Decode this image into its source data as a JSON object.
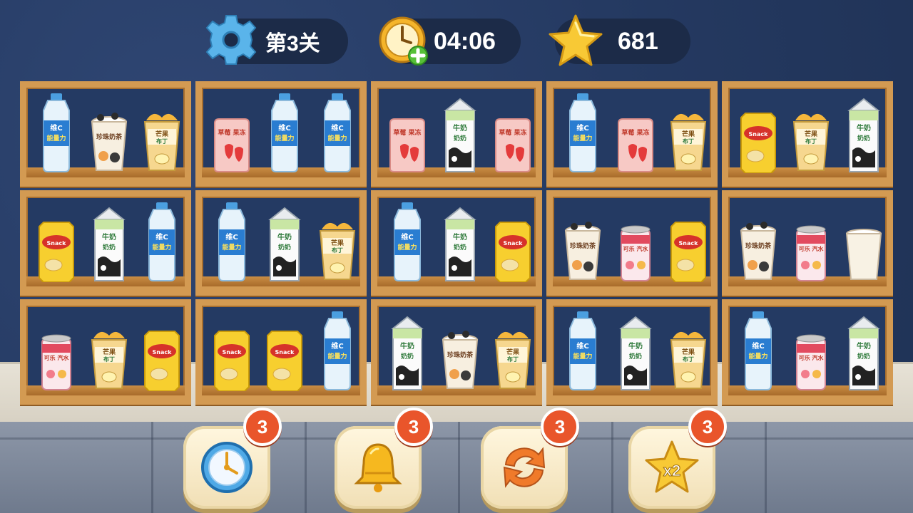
{
  "hud": {
    "level_label": "第3关",
    "timer": "04:06",
    "score": "681"
  },
  "item_labels": {
    "water": "维C 能量力",
    "milk": "牛奶 奶奶",
    "cup": "珍珠奶茶",
    "mango": "芒果 布丁",
    "strawberry": "草莓 果冻",
    "chips": "Snack",
    "can": "可乐 汽水"
  },
  "shelves": [
    [
      [
        "water",
        "cup",
        "mango"
      ],
      [
        "strawberry",
        "water",
        "water"
      ],
      [
        "strawberry",
        "milk",
        "strawberry"
      ],
      [
        "water",
        "strawberry",
        "mango"
      ],
      [
        "chips",
        "mango",
        "milk"
      ]
    ],
    [
      [
        "chips",
        "milk",
        "water"
      ],
      [
        "water",
        "milk",
        "mango"
      ],
      [
        "water",
        "milk",
        "chips"
      ],
      [
        "cup",
        "can",
        "chips"
      ],
      [
        "cup",
        "can",
        "empty_cup"
      ]
    ],
    [
      [
        "can",
        "mango",
        "chips"
      ],
      [
        "chips",
        "chips",
        "water"
      ],
      [
        "milk",
        "cup",
        "mango"
      ],
      [
        "water",
        "milk",
        "mango"
      ],
      [
        "water",
        "can",
        "milk"
      ]
    ]
  ],
  "powerups": [
    {
      "name": "clock",
      "count": "3"
    },
    {
      "name": "bell",
      "count": "3"
    },
    {
      "name": "refresh",
      "count": "3"
    },
    {
      "name": "double-star",
      "count": "3",
      "label": "x2"
    }
  ],
  "colors": {
    "accent_orange": "#e9552b",
    "shelf_wood": "#d39a52",
    "wall_navy": "#253a62",
    "hud_pill": "#1c2b48",
    "star_gold": "#f8c935"
  }
}
